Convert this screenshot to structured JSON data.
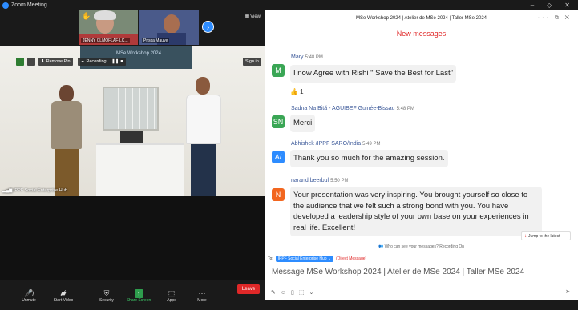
{
  "window": {
    "title": "Zoom Meeting",
    "controls": [
      "–",
      "◇",
      "✕"
    ]
  },
  "thumbnails": [
    {
      "name": "JENNY CLMOFLAF-LC..."
    },
    {
      "name": "Prisca Mauve"
    }
  ],
  "view_label": "View",
  "video_overlay": {
    "remove_pin": "Remove Pin",
    "recording": "Recording...",
    "sign_in": "Sign in",
    "screen_text": "MSe Workshop 2024"
  },
  "video_label": "IPPF Social Enterprise Hub",
  "toolbar": {
    "unmute": "Unmute",
    "start_video": "Start Video",
    "security": "Security",
    "share_screen": "Share Screen",
    "apps": "Apps",
    "more": "More",
    "leave": "Leave"
  },
  "chat": {
    "title": "MSe Workshop 2024 | Atelier de MSe 2024 | Taller MSe 2024",
    "header_icons": "··· ⧉ ✕",
    "new_messages": "New messages",
    "messages": [
      {
        "initials": "M",
        "avatar_color": "#3aa655",
        "sender": "Mary",
        "time": "5:48 PM",
        "text": "I now Agree with Rishi \" Save the Best for Last\"",
        "reaction": "👍 1"
      },
      {
        "initials": "SN",
        "avatar_color": "#3aa655",
        "sender": "Sadna Na Bitã - AGUIBEF Guinée-Bissau",
        "time": "5:48 PM",
        "text": "Merci"
      },
      {
        "initials": "A/",
        "avatar_color": "#2d8cff",
        "sender": "Abhishek /IPPF SARO/India",
        "time": "5:49 PM",
        "text": "Thank you so much for the amazing session."
      },
      {
        "initials": "N",
        "avatar_color": "#f2661f",
        "sender": "narand.beerbul",
        "time": "5:50 PM",
        "text": "Your presentation was very inspiring. You brought yourself so close to the audience that we felt such a strong bond with you. You have developed a leadership style of your own base on your experiences in real life. Excellent!"
      }
    ],
    "jump_to_latest": "Jump to the latest",
    "who_can_see": "Who can see your messages? Recording On",
    "to_label": "To:",
    "to_recipient": "IPPF Social Enterprise Hub ⌄",
    "direct_message": "(Direct Message)",
    "compose_placeholder": "Message MSe Workshop 2024 | Atelier de MSe 2024 | Taller MSe 2024"
  }
}
